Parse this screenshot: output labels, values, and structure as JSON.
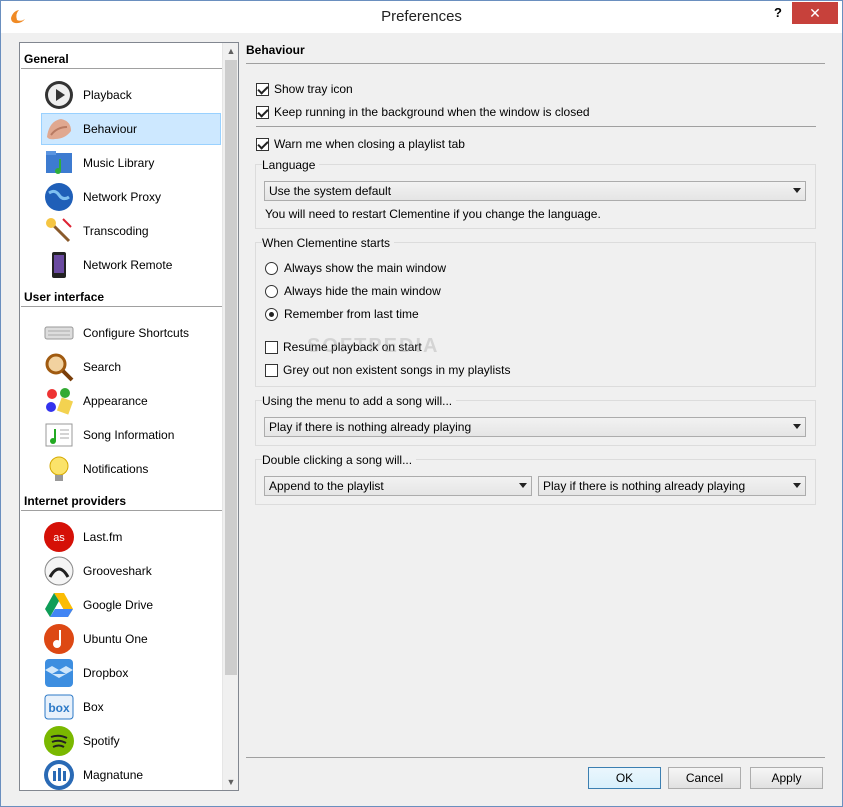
{
  "window": {
    "title": "Preferences",
    "help_label": "?",
    "close_label": "✕"
  },
  "sidebar": {
    "sections": [
      {
        "header": "General",
        "items": [
          {
            "label": "Playback",
            "icon": "play-icon"
          },
          {
            "label": "Behaviour",
            "icon": "behaviour-icon",
            "selected": true
          },
          {
            "label": "Music Library",
            "icon": "music-folder-icon"
          },
          {
            "label": "Network Proxy",
            "icon": "globe-icon"
          },
          {
            "label": "Transcoding",
            "icon": "transcoding-icon"
          },
          {
            "label": "Network Remote",
            "icon": "remote-phone-icon"
          }
        ]
      },
      {
        "header": "User interface",
        "items": [
          {
            "label": "Configure Shortcuts",
            "icon": "keyboard-icon"
          },
          {
            "label": "Search",
            "icon": "search-icon"
          },
          {
            "label": "Appearance",
            "icon": "palette-icon"
          },
          {
            "label": "Song Information",
            "icon": "song-info-icon"
          },
          {
            "label": "Notifications",
            "icon": "lightbulb-icon"
          }
        ]
      },
      {
        "header": "Internet providers",
        "items": [
          {
            "label": "Last.fm",
            "icon": "lastfm-icon"
          },
          {
            "label": "Grooveshark",
            "icon": "grooveshark-icon"
          },
          {
            "label": "Google Drive",
            "icon": "google-drive-icon"
          },
          {
            "label": "Ubuntu One",
            "icon": "ubuntu-one-icon"
          },
          {
            "label": "Dropbox",
            "icon": "dropbox-icon"
          },
          {
            "label": "Box",
            "icon": "box-icon"
          },
          {
            "label": "Spotify",
            "icon": "spotify-icon"
          },
          {
            "label": "Magnatune",
            "icon": "magnatune-icon"
          }
        ]
      }
    ]
  },
  "panel": {
    "title": "Behaviour",
    "show_tray_icon": {
      "label": "Show tray icon",
      "checked": true
    },
    "keep_running": {
      "label": "Keep running in the background when the window is closed",
      "checked": true
    },
    "warn_closing": {
      "label": "Warn me when closing a playlist tab",
      "checked": true
    },
    "language": {
      "group_title": "Language",
      "selected": "Use the system default",
      "note": "You will need to restart Clementine if you change the language."
    },
    "startup": {
      "group_title": "When Clementine starts",
      "options": [
        {
          "label": "Always show the main window",
          "selected": false
        },
        {
          "label": "Always hide the main window",
          "selected": false
        },
        {
          "label": "Remember from last time",
          "selected": true
        }
      ],
      "resume_playback": {
        "label": "Resume playback on start",
        "checked": false
      },
      "grey_out": {
        "label": "Grey out non existent songs in my playlists",
        "checked": false
      }
    },
    "menu_add": {
      "group_title": "Using the menu to add a song will...",
      "selected": "Play if there is nothing already playing"
    },
    "double_click": {
      "group_title": "Double clicking a song will...",
      "selected_left": "Append to the playlist",
      "selected_right": "Play if there is nothing already playing"
    }
  },
  "watermark": "SOFTPEDIA",
  "buttons": {
    "ok": "OK",
    "cancel": "Cancel",
    "apply": "Apply"
  }
}
